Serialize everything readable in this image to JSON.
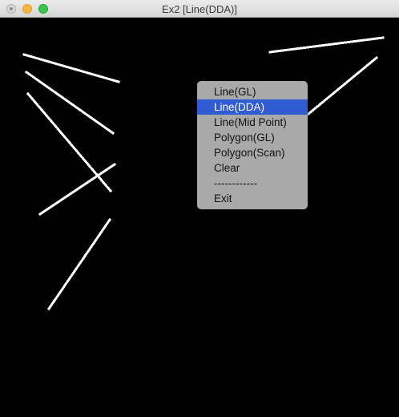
{
  "window": {
    "title": "Ex2  [Line(DDA)]"
  },
  "context_menu": {
    "items": [
      {
        "label": "Line(GL)",
        "selected": false
      },
      {
        "label": "Line(DDA)",
        "selected": true
      },
      {
        "label": "Line(Mid Point)",
        "selected": false
      },
      {
        "label": "Polygon(GL)",
        "selected": false
      },
      {
        "label": "Polygon(Scan)",
        "selected": false
      },
      {
        "label": "Clear",
        "selected": false
      },
      {
        "label": "------------",
        "selected": false
      },
      {
        "label": "Exit",
        "selected": false
      }
    ],
    "selected_color": "#2f5bd3"
  },
  "canvas": {
    "background": "#000000",
    "line_color": "#ffffff",
    "line_count": 8
  }
}
